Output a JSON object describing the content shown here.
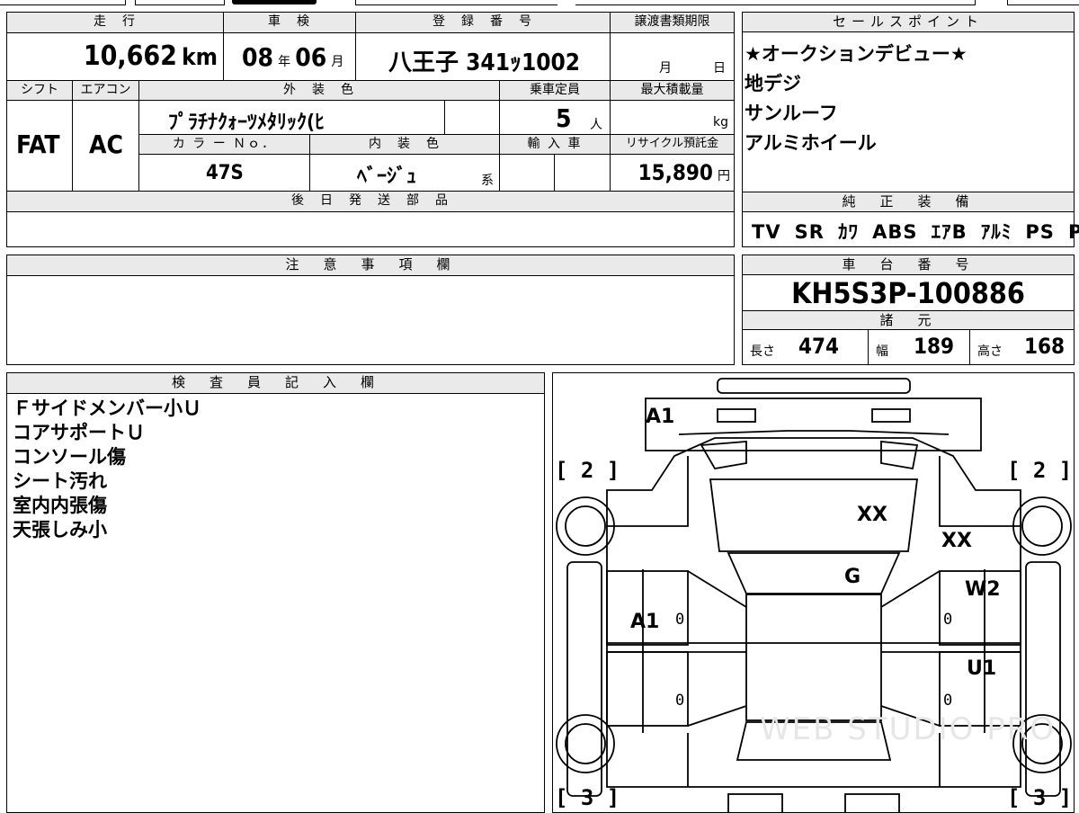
{
  "top_table": {
    "mileage_label": "走　行",
    "mileage_value": "10,662",
    "mileage_unit": "km",
    "inspection_label": "車　検",
    "inspection_year": "08",
    "inspection_year_unit": "年",
    "inspection_month": "06",
    "inspection_month_unit": "月",
    "registration_label": "登　録　番　号",
    "registration_value": "八王子 341ｯ1002",
    "transfer_deadline_label": "譲渡書類期限",
    "transfer_month_unit": "月",
    "transfer_day_unit": "日",
    "shift_label": "シフト",
    "shift_value": "FAT",
    "ac_label": "エアコン",
    "ac_value": "AC",
    "exterior_color_label": "外　装　色",
    "exterior_color_value": "ﾌﾟﾗﾁﾅｸｫｰﾂﾒﾀﾘｯｸ(ﾋ",
    "capacity_label": "乗車定員",
    "capacity_value": "5",
    "capacity_unit": "人",
    "max_load_label": "最大積載量",
    "max_load_unit": "kg",
    "color_no_label": "カ ラ ー Ｎｏ．",
    "color_no_value": "47S",
    "interior_color_label": "内　装　色",
    "interior_color_value": "ﾍﾞｰｼﾞｭ",
    "interior_color_suffix": "系",
    "import_label": "輸 入 車",
    "recycle_label": "リサイクル預託金",
    "recycle_value": "15,890",
    "recycle_unit": "円",
    "later_parts_label": "後　日　発　送　部　品"
  },
  "sales_points": {
    "header": "セールスポイント",
    "items": [
      "★オークションデビュー★",
      "地デジ",
      "サンルーフ",
      "アルミホイール"
    ]
  },
  "equipment": {
    "header": "純　正　装　備",
    "items": [
      "TV",
      "SR",
      "ｶﾜ",
      "ABS",
      "ｴｱB",
      "ｱﾙﾐ",
      "PS",
      "PW"
    ]
  },
  "notes": {
    "header": "注　意　事　項　欄"
  },
  "chassis": {
    "header": "車　台　番　号",
    "value": "KH5S3P-100886"
  },
  "specs": {
    "header": "諸　元",
    "length_label": "長さ",
    "length_value": "474",
    "width_label": "幅",
    "width_value": "189",
    "height_label": "高さ",
    "height_value": "168"
  },
  "inspector": {
    "header": "検　査　員　記　入　欄",
    "lines": [
      "Ｆサイドメンバー小Ｕ",
      "コアサポートＵ",
      "コンソール傷",
      "シート汚れ",
      "室内内張傷",
      "天張しみ小"
    ]
  },
  "diagram": {
    "mark_front": "A1",
    "mark_hood": "XX",
    "mark_right_fender": "XX",
    "mark_windshield": "G",
    "mark_left_door": "A1",
    "mark_right_front_door": "W2",
    "mark_right_rear_door": "U1",
    "zero": "0",
    "bracket_tl": "[ 2 ]",
    "bracket_tr": "[ 2 ]",
    "bracket_bl": "[ 3 ]",
    "bracket_br": "[ 3 ]",
    "watermark": "WEB STUDIO PRO"
  }
}
